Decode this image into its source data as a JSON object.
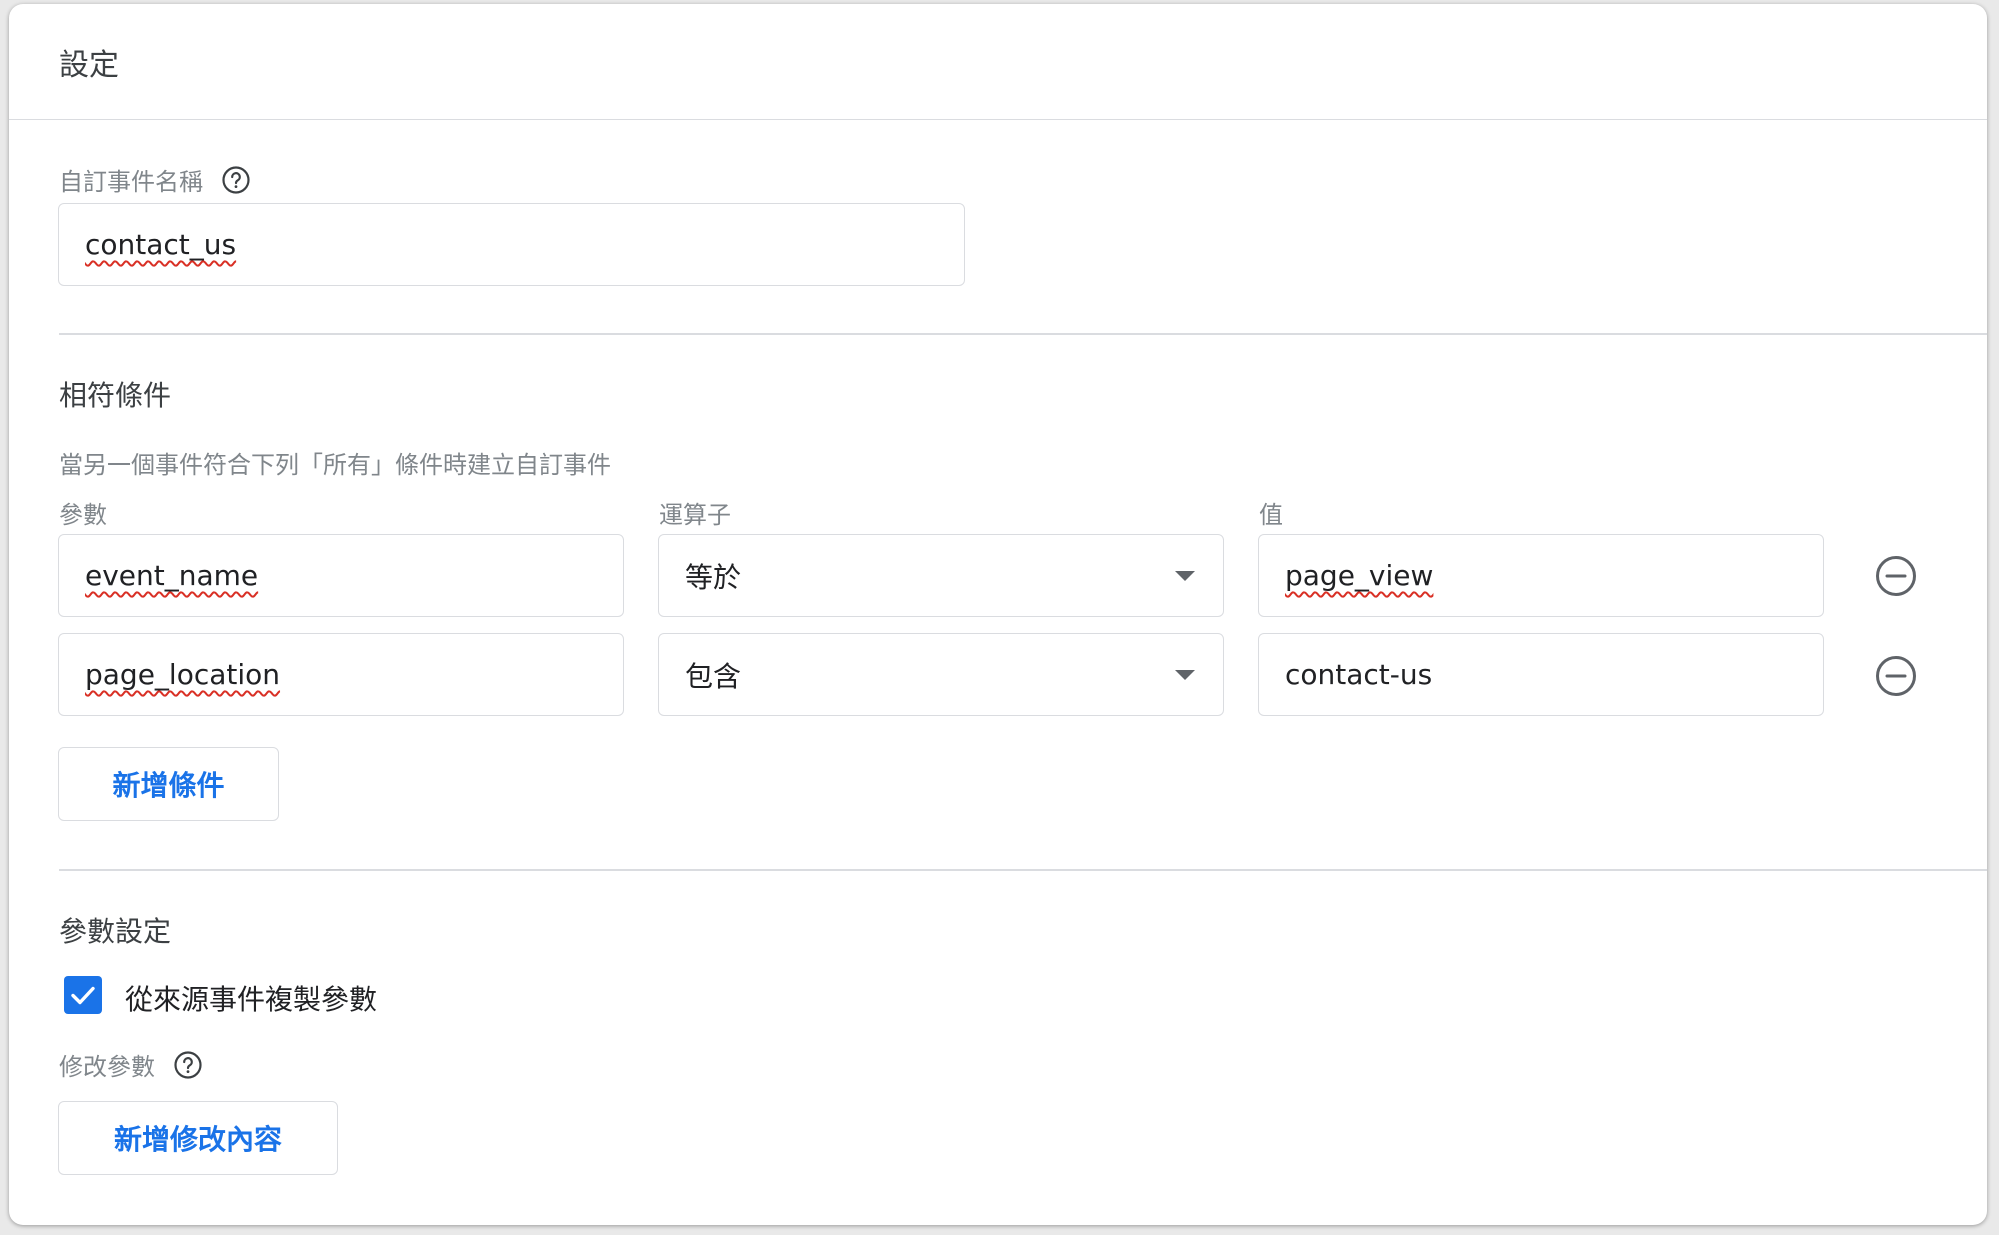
{
  "header": {
    "title": "設定"
  },
  "custom_event": {
    "label": "自訂事件名稱",
    "value": "contact_us"
  },
  "matching": {
    "title": "相符條件",
    "description": "當另一個事件符合下列「所有」條件時建立自訂事件",
    "columns": {
      "param": "參數",
      "operator": "運算子",
      "value": "值"
    },
    "rows": [
      {
        "param": "event_name",
        "operator": "等於",
        "value": "page_view"
      },
      {
        "param": "page_location",
        "operator": "包含",
        "value": "contact-us"
      }
    ],
    "add_button": "新增條件"
  },
  "param_settings": {
    "title": "參數設定",
    "copy_checkbox_label": "從來源事件複製參數",
    "copy_checked": true,
    "modify_label": "修改參數",
    "add_modification_button": "新增修改內容"
  },
  "colors": {
    "accent": "#1a73e8",
    "border": "#dadce0",
    "muted": "#80868b"
  }
}
